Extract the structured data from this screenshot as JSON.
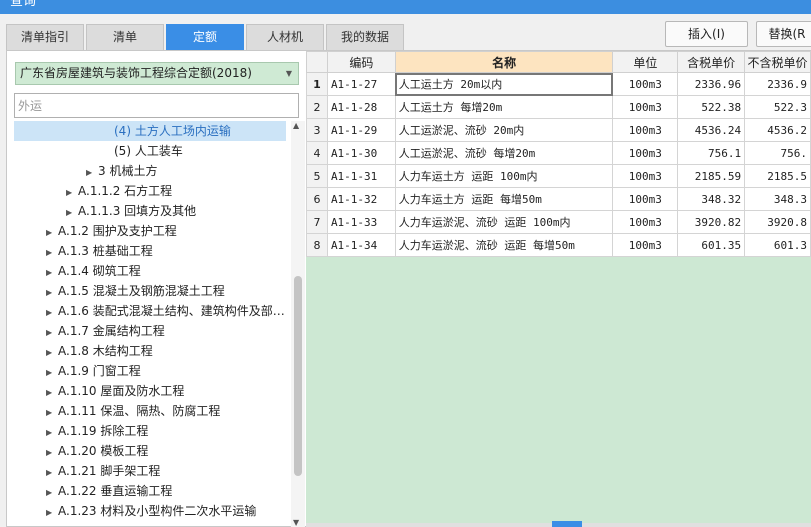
{
  "window": {
    "title": "查询"
  },
  "tabs": [
    {
      "label": "清单指引",
      "active": false
    },
    {
      "label": "清单",
      "active": false
    },
    {
      "label": "定额",
      "active": true
    },
    {
      "label": "人材机",
      "active": false
    },
    {
      "label": "我的数据",
      "active": false
    }
  ],
  "toolbar": {
    "insert_label": "插入(I)",
    "replace_label": "替换(R"
  },
  "library": {
    "selected": "广东省房屋建筑与装饰工程综合定额(2018)"
  },
  "search": {
    "value": "外运"
  },
  "tree": [
    {
      "label": "(4) 土方人工场内运输",
      "indent": 100,
      "arrow": false,
      "selected": true
    },
    {
      "label": "(5) 人工装车",
      "indent": 100,
      "arrow": false,
      "selected": false
    },
    {
      "label": "3 机械土方",
      "indent": 72,
      "arrow": true,
      "selected": false
    },
    {
      "label": "A.1.1.2 石方工程",
      "indent": 52,
      "arrow": true,
      "selected": false
    },
    {
      "label": "A.1.1.3 回填方及其他",
      "indent": 52,
      "arrow": true,
      "selected": false
    },
    {
      "label": "A.1.2 围护及支护工程",
      "indent": 32,
      "arrow": true,
      "selected": false
    },
    {
      "label": "A.1.3 桩基础工程",
      "indent": 32,
      "arrow": true,
      "selected": false
    },
    {
      "label": "A.1.4 砌筑工程",
      "indent": 32,
      "arrow": true,
      "selected": false
    },
    {
      "label": "A.1.5 混凝土及钢筋混凝土工程",
      "indent": 32,
      "arrow": true,
      "selected": false
    },
    {
      "label": "A.1.6 装配式混凝土结构、建筑构件及部…",
      "indent": 32,
      "arrow": true,
      "selected": false
    },
    {
      "label": "A.1.7 金属结构工程",
      "indent": 32,
      "arrow": true,
      "selected": false
    },
    {
      "label": "A.1.8 木结构工程",
      "indent": 32,
      "arrow": true,
      "selected": false
    },
    {
      "label": "A.1.9 门窗工程",
      "indent": 32,
      "arrow": true,
      "selected": false
    },
    {
      "label": "A.1.10 屋面及防水工程",
      "indent": 32,
      "arrow": true,
      "selected": false
    },
    {
      "label": "A.1.11 保温、隔热、防腐工程",
      "indent": 32,
      "arrow": true,
      "selected": false
    },
    {
      "label": "A.1.19 拆除工程",
      "indent": 32,
      "arrow": true,
      "selected": false
    },
    {
      "label": "A.1.20 模板工程",
      "indent": 32,
      "arrow": true,
      "selected": false
    },
    {
      "label": "A.1.21 脚手架工程",
      "indent": 32,
      "arrow": true,
      "selected": false
    },
    {
      "label": "A.1.22 垂直运输工程",
      "indent": 32,
      "arrow": true,
      "selected": false
    },
    {
      "label": "A.1.23 材料及小型构件二次水平运输",
      "indent": 32,
      "arrow": true,
      "selected": false
    }
  ],
  "table": {
    "columns": [
      "",
      "编码",
      "名称",
      "单位",
      "含税单价",
      "不含税单价"
    ],
    "rows": [
      {
        "no": "1",
        "code": "A1-1-27",
        "name": "人工运土方 20m以内",
        "unit": "100m3",
        "price": "2336.96",
        "price_ex": "2336.9"
      },
      {
        "no": "2",
        "code": "A1-1-28",
        "name": "人工运土方 每增20m",
        "unit": "100m3",
        "price": "522.38",
        "price_ex": "522.3"
      },
      {
        "no": "3",
        "code": "A1-1-29",
        "name": "人工运淤泥、流砂 20m内",
        "unit": "100m3",
        "price": "4536.24",
        "price_ex": "4536.2"
      },
      {
        "no": "4",
        "code": "A1-1-30",
        "name": "人工运淤泥、流砂 每增20m",
        "unit": "100m3",
        "price": "756.1",
        "price_ex": "756."
      },
      {
        "no": "5",
        "code": "A1-1-31",
        "name": "人力车运土方 运距 100m内",
        "unit": "100m3",
        "price": "2185.59",
        "price_ex": "2185.5"
      },
      {
        "no": "6",
        "code": "A1-1-32",
        "name": "人力车运土方 运距 每增50m",
        "unit": "100m3",
        "price": "348.32",
        "price_ex": "348.3"
      },
      {
        "no": "7",
        "code": "A1-1-33",
        "name": "人力车运淤泥、流砂 运距 100m内",
        "unit": "100m3",
        "price": "3920.82",
        "price_ex": "3920.8"
      },
      {
        "no": "8",
        "code": "A1-1-34",
        "name": "人力车运淤泥、流砂 运距 每增50m",
        "unit": "100m3",
        "price": "601.35",
        "price_ex": "601.3"
      }
    ]
  },
  "colors": {
    "accent": "#3a8ee6",
    "grid_bg": "#cde8d3",
    "header_name_bg": "#fde4c0",
    "tree_selected": "#cce4f7"
  }
}
